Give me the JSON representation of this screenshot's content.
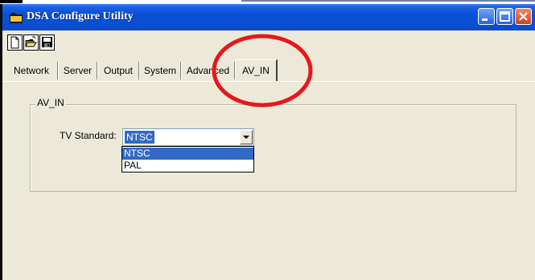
{
  "window": {
    "title": "DSA Configure Utility",
    "controls": [
      "minimize",
      "maximize",
      "close"
    ]
  },
  "toolbar": {
    "icons": [
      "new-file-icon",
      "open-folder-icon",
      "save-icon"
    ]
  },
  "tabs": [
    {
      "label": "Network",
      "active": false
    },
    {
      "label": "Server",
      "active": false
    },
    {
      "label": "Output",
      "active": false
    },
    {
      "label": "System",
      "active": false
    },
    {
      "label": "Advanced",
      "active": false
    },
    {
      "label": "AV_IN",
      "active": true
    }
  ],
  "av_in": {
    "group_label": "AV_IN",
    "tv_standard_label": "TV Standard:",
    "tv_standard_value": "NTSC",
    "options": [
      "NTSC",
      "PAL"
    ],
    "highlighted_option": "NTSC"
  },
  "colors": {
    "title_bar": "#0a4fd6",
    "selection": "#316ac5",
    "annotation_circle": "#e8161b",
    "window_face": "#ece9d8"
  }
}
